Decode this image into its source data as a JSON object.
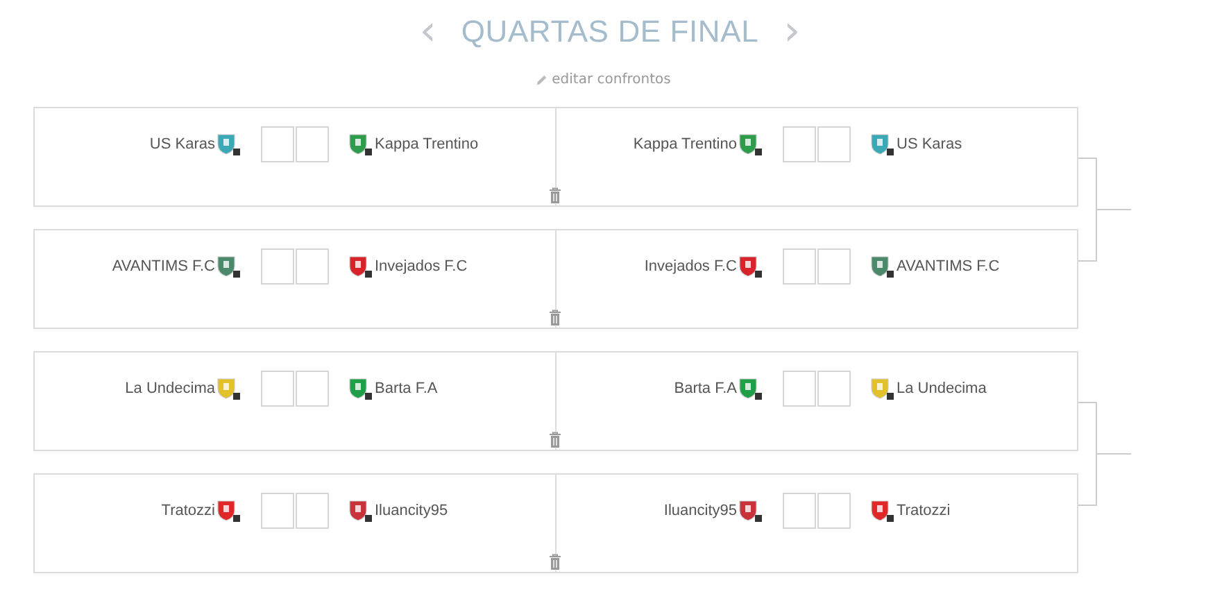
{
  "header": {
    "prev": "‹",
    "title": "QUARTAS DE FINAL",
    "next": "›",
    "edit_link": "editar confrontos"
  },
  "matches": [
    {
      "legs": [
        {
          "home": {
            "name": "US Karas",
            "color": "#3aa9b5"
          },
          "away": {
            "name": "Kappa Trentino",
            "color": "#2e9c4a"
          }
        },
        {
          "home": {
            "name": "Kappa Trentino",
            "color": "#2e9c4a"
          },
          "away": {
            "name": "US Karas",
            "color": "#3aa9b5"
          }
        }
      ]
    },
    {
      "legs": [
        {
          "home": {
            "name": "AVANTIMS F.C",
            "color": "#4a8a6a"
          },
          "away": {
            "name": "Invejados F.C",
            "color": "#d8232a"
          }
        },
        {
          "home": {
            "name": "Invejados F.C",
            "color": "#d8232a"
          },
          "away": {
            "name": "AVANTIMS F.C",
            "color": "#4a8a6a"
          }
        }
      ]
    },
    {
      "legs": [
        {
          "home": {
            "name": "La Undecima",
            "color": "#e2c12a"
          },
          "away": {
            "name": "Barta F.A",
            "color": "#1fa048"
          }
        },
        {
          "home": {
            "name": "Barta F.A",
            "color": "#1fa048"
          },
          "away": {
            "name": "La Undecima",
            "color": "#e2c12a"
          }
        }
      ]
    },
    {
      "legs": [
        {
          "home": {
            "name": "Tratozzi",
            "color": "#e02828"
          },
          "away": {
            "name": "Iluancity95",
            "color": "#c8323a"
          }
        },
        {
          "home": {
            "name": "Iluancity95",
            "color": "#c8323a"
          },
          "away": {
            "name": "Tratozzi",
            "color": "#e02828"
          }
        }
      ]
    }
  ]
}
